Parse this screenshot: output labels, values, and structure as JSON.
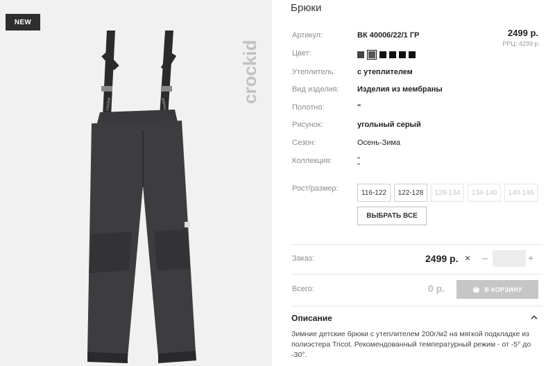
{
  "badge": "NEW",
  "brand": "crockid",
  "product": {
    "title": "Брюки",
    "price": "2499 р.",
    "rrp": "РРЦ: 4299 р."
  },
  "specs": {
    "article_label": "Артикул:",
    "article_value": "ВК 40006/22/1 ГР",
    "color_label": "Цвет:",
    "filler_label": "Утеплитель:",
    "filler_value": "с утеплителем",
    "type_label": "Вид изделия:",
    "type_value": "Изделия из мембраны",
    "fabric_label": "Полотно:",
    "fabric_value": "\"",
    "pattern_label": "Рисунок:",
    "pattern_value": "угольный серый",
    "season_label": "Сезон:",
    "season_value": "Осень-Зима",
    "collection_label": "Коллекция:",
    "collection_value": "\""
  },
  "colors": [
    "#111111",
    "#555555",
    "#111111",
    "#111111",
    "#111111",
    "#111111"
  ],
  "size_label": "Рост/размер:",
  "sizes": [
    {
      "label": "116-122",
      "available": true
    },
    {
      "label": "122-128",
      "available": true
    },
    {
      "label": "128-134",
      "available": false
    },
    {
      "label": "134-140",
      "available": false
    },
    {
      "label": "140-146",
      "available": false
    }
  ],
  "select_all": "ВЫБРАТЬ ВСЕ",
  "order": {
    "label": "Заказ:",
    "price": "2499 р.",
    "times": "×",
    "minus": "–",
    "plus": "+",
    "quantity": ""
  },
  "total": {
    "label": "Всего:",
    "value": "0 р.",
    "cart_button": "В КОРЗИНУ"
  },
  "description": {
    "heading": "Описание",
    "text": "Зимние детские брюки с утеплителем 200г/м2 на мягкой подкладке из полиэстера Tricot. Рекомендованный температурный режим - от -5° до -30°."
  }
}
